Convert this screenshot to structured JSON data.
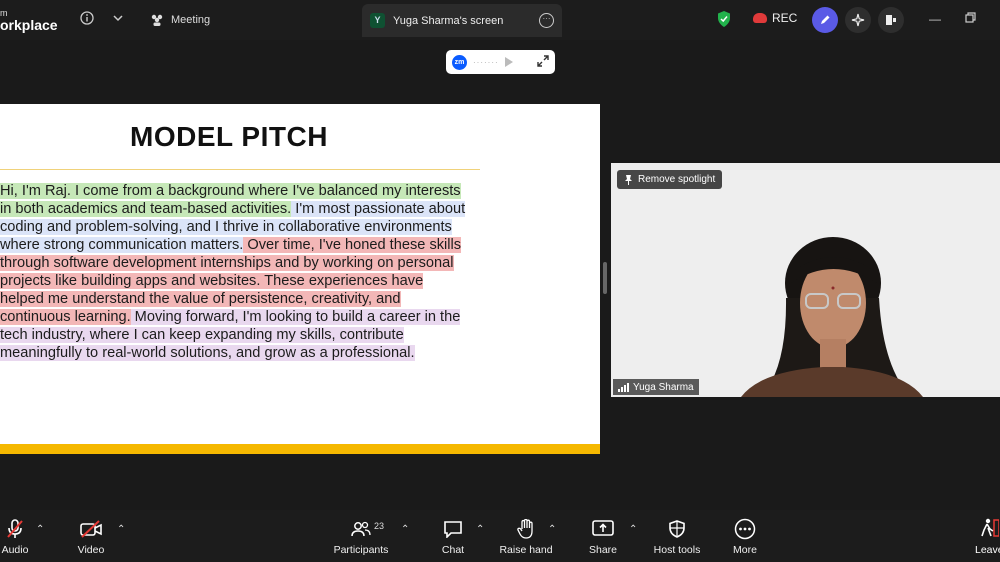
{
  "app": {
    "brand_top": "m",
    "brand_name": "orkplace"
  },
  "topbar": {
    "meeting_label": "Meeting",
    "screen_tab_initial": "Y",
    "screen_tab_label": "Yuga Sharma's screen",
    "rec_label": "REC"
  },
  "slide": {
    "title": "MODEL PITCH",
    "segments": [
      "Hi, I'm Raj. I come from a background where I've balanced my interests in both academics and team-based activities.",
      " I'm most passionate about coding and problem-solving, and I thrive in collaborative environments where strong communication matters.",
      " Over time, I've honed these skills through software development internships and by working on personal projects like building apps and websites. These experiences have helped me understand the value of persistence, creativity, and continuous learning.",
      " Moving forward, I'm looking to build a career in the tech industry, where I can keep expanding my skills, contribute meaningfully to real-world solutions, and grow as a professional."
    ]
  },
  "video": {
    "spotlight_label": "Remove spotlight",
    "participant_name": "Yuga Sharma"
  },
  "toolbar": {
    "audio": "Audio",
    "video": "Video",
    "participants": "Participants",
    "participants_count": "23",
    "chat": "Chat",
    "raise_hand": "Raise hand",
    "share": "Share",
    "host_tools": "Host tools",
    "more": "More",
    "leave": "Leave"
  },
  "colors": {
    "accent_blue": "#0b5cff",
    "rec_red": "#e03a3a",
    "slide_bar": "#f5b800",
    "highlight_green": "#c6e8b8",
    "highlight_blue": "#dbe4f8",
    "highlight_red": "#f3b7b7",
    "highlight_purple": "#e9d8ef"
  }
}
